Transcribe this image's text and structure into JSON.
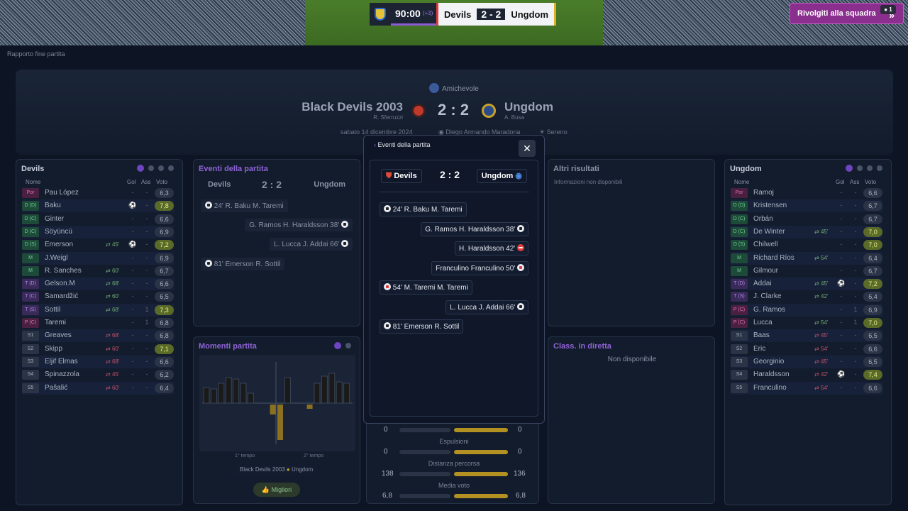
{
  "topbar": {
    "time": "90:00",
    "added": "(+3)",
    "home": "Devils",
    "score": "2 - 2",
    "away": "Ungdom",
    "back_label": "Rivolgiti alla squadra",
    "user_count": "1"
  },
  "breadcrumb": "Rapporto fine partita",
  "header": {
    "competition": "Amichevole",
    "home_team": "Black Devils 2003",
    "home_manager": "R. Sferruzzi",
    "score": "2 : 2",
    "away_team": "Ungdom",
    "away_manager": "A. Busa",
    "date": "sabato 14 dicembre 2024",
    "stadium": "Diego Armando Maradona",
    "weather": "Sereno"
  },
  "home_lineup": {
    "title": "Devils",
    "cols": {
      "name": "Nome",
      "gol": "Gol",
      "ass": "Ass",
      "voto": "Voto"
    },
    "players": [
      {
        "pos": "Por",
        "name": "Pau López",
        "sub": "",
        "gol": "-",
        "ass": "-",
        "voto": "6,3"
      },
      {
        "pos": "D (D)",
        "name": "Baku",
        "sub": "",
        "gol": "ball",
        "ass": "-",
        "voto": "7,8"
      },
      {
        "pos": "D (C)",
        "name": "Ginter",
        "sub": "",
        "gol": "-",
        "ass": "-",
        "voto": "6,6"
      },
      {
        "pos": "D (C)",
        "name": "Söyüncü",
        "sub": "",
        "gol": "-",
        "ass": "-",
        "voto": "6,9"
      },
      {
        "pos": "D (S)",
        "name": "Emerson",
        "sub": "45'",
        "gol": "ball",
        "ass": "-",
        "voto": "7,2"
      },
      {
        "pos": "M",
        "name": "J.Weigl",
        "sub": "",
        "gol": "-",
        "ass": "-",
        "voto": "6,9"
      },
      {
        "pos": "M",
        "name": "R. Sanches",
        "sub": "60'",
        "gol": "-",
        "ass": "-",
        "voto": "6,7"
      },
      {
        "pos": "T (D)",
        "name": "Gelson.M",
        "sub": "68'",
        "gol": "-",
        "ass": "-",
        "voto": "6,6"
      },
      {
        "pos": "T (C)",
        "name": "Samardžić",
        "sub": "60'",
        "gol": "-",
        "ass": "-",
        "voto": "6,5"
      },
      {
        "pos": "T (S)",
        "name": "Sottil",
        "sub": "68'",
        "gol": "-",
        "ass": "1",
        "voto": "7,3"
      },
      {
        "pos": "P (C)",
        "name": "Taremi",
        "sub": "",
        "gol": "-",
        "ass": "1",
        "voto": "6,8"
      },
      {
        "pos": "S1",
        "name": "Greaves",
        "sub": "68'",
        "gol": "-",
        "ass": "-",
        "voto": "6,8"
      },
      {
        "pos": "S2",
        "name": "Skipp",
        "sub": "60'",
        "gol": "-",
        "ass": "-",
        "voto": "7,1"
      },
      {
        "pos": "S3",
        "name": "Eljif Elmas",
        "sub": "68'",
        "gol": "-",
        "ass": "-",
        "voto": "6,6"
      },
      {
        "pos": "S4",
        "name": "Spinazzola",
        "sub": "45'",
        "gol": "-",
        "ass": "-",
        "voto": "6,2"
      },
      {
        "pos": "S5",
        "name": "Pašalić",
        "sub": "60'",
        "gol": "-",
        "ass": "-",
        "voto": "6,4"
      }
    ]
  },
  "away_lineup": {
    "title": "Ungdom",
    "cols": {
      "name": "Nome",
      "gol": "Gol",
      "ass": "Ass",
      "voto": "Voto"
    },
    "players": [
      {
        "pos": "Por",
        "name": "Ramoj",
        "sub": "",
        "gol": "-",
        "ass": "-",
        "voto": "6,6"
      },
      {
        "pos": "D (D)",
        "name": "Kristensen",
        "sub": "",
        "gol": "-",
        "ass": "-",
        "voto": "6,7"
      },
      {
        "pos": "D (C)",
        "name": "Orbán",
        "sub": "",
        "gol": "-",
        "ass": "-",
        "voto": "6,7"
      },
      {
        "pos": "D (C)",
        "name": "De Winter",
        "sub": "45'",
        "gol": "-",
        "ass": "-",
        "voto": "7,0"
      },
      {
        "pos": "D (S)",
        "name": "Chilwell",
        "sub": "",
        "gol": "-",
        "ass": "-",
        "voto": "7,0"
      },
      {
        "pos": "M",
        "name": "Richard Ríos",
        "sub": "54'",
        "gol": "-",
        "ass": "-",
        "voto": "6,4"
      },
      {
        "pos": "M",
        "name": "Gilmour",
        "sub": "",
        "gol": "-",
        "ass": "-",
        "voto": "6,7"
      },
      {
        "pos": "T (D)",
        "name": "Addai",
        "sub": "45'",
        "gol": "ball",
        "ass": "-",
        "voto": "7,2"
      },
      {
        "pos": "T (S)",
        "name": "J. Clarke",
        "sub": "42'",
        "gol": "-",
        "ass": "-",
        "voto": "6,4"
      },
      {
        "pos": "P (C)",
        "name": "G. Ramos",
        "sub": "",
        "gol": "-",
        "ass": "1",
        "voto": "6,9"
      },
      {
        "pos": "P (C)",
        "name": "Lucca",
        "sub": "54'",
        "gol": "-",
        "ass": "1",
        "voto": "7,0"
      },
      {
        "pos": "S1",
        "name": "Baas",
        "sub": "45'",
        "gol": "-",
        "ass": "-",
        "voto": "6,5"
      },
      {
        "pos": "S2",
        "name": "Eric",
        "sub": "54'",
        "gol": "-",
        "ass": "-",
        "voto": "6,6"
      },
      {
        "pos": "S3",
        "name": "Georginio",
        "sub": "45'",
        "gol": "-",
        "ass": "-",
        "voto": "6,5"
      },
      {
        "pos": "S4",
        "name": "Haraldsson",
        "sub": "42'",
        "gol": "ball",
        "ass": "-",
        "voto": "7,4"
      },
      {
        "pos": "S5",
        "name": "Franculino",
        "sub": "54'",
        "gol": "-",
        "ass": "-",
        "voto": "6,6"
      }
    ]
  },
  "events_panel": {
    "title": "Eventi della partita",
    "home": "Devils",
    "score": "2 : 2",
    "away": "Ungdom",
    "rows": [
      {
        "text": "24' R. Baku M. Taremi",
        "side": "home"
      },
      {
        "text": "G. Ramos H. Haraldsson 38'",
        "side": "away"
      },
      {
        "text": "L. Lucca J. Addai 66'",
        "side": "away"
      },
      {
        "text": "81' Emerson R. Sottil",
        "side": "home"
      }
    ]
  },
  "other_results": {
    "title": "Altri risultati",
    "text": "Informazioni non disponibili"
  },
  "momenti": {
    "title": "Momenti partita",
    "first_half": "1° tempo",
    "second_half": "2° tempo",
    "legend_home": "Black Devils 2003",
    "legend_away": "Ungdom",
    "button": "Migliori"
  },
  "class": {
    "title": "Class. in diretta",
    "text": "Non disponibile"
  },
  "stats": [
    {
      "home": "0",
      "away": "0",
      "label": "Espulsioni"
    },
    {
      "home": "0",
      "away": "0",
      "label": "Distanza percorsa"
    },
    {
      "home": "138",
      "away": "136",
      "label": "Media voto"
    },
    {
      "home": "6,8",
      "away": "6,8",
      "label": ""
    }
  ],
  "modal": {
    "title": "Eventi della partita",
    "home": "Devils",
    "score": "2 : 2",
    "away": "Ungdom",
    "events": [
      {
        "text": "24'  R. Baku  M. Taremi",
        "side": "home",
        "icon": "goal"
      },
      {
        "text": "G. Ramos  H. Haraldsson  38'",
        "side": "away",
        "icon": "goal"
      },
      {
        "text": "H. Haraldsson  42'",
        "side": "away",
        "icon": "injury"
      },
      {
        "text": "Franculino  Franculino  50'",
        "side": "away",
        "icon": "owngoal"
      },
      {
        "text": "54'  M. Taremi  M. Taremi",
        "side": "home",
        "icon": "owngoal"
      },
      {
        "text": "L. Lucca  J. Addai  66'",
        "side": "away",
        "icon": "goal"
      },
      {
        "text": "81'  Emerson  R. Sottil",
        "side": "home",
        "icon": "goal"
      }
    ]
  },
  "colors": {
    "accent": "#8f63d6",
    "home": "#1a1a1a",
    "away": "#c9a227"
  }
}
